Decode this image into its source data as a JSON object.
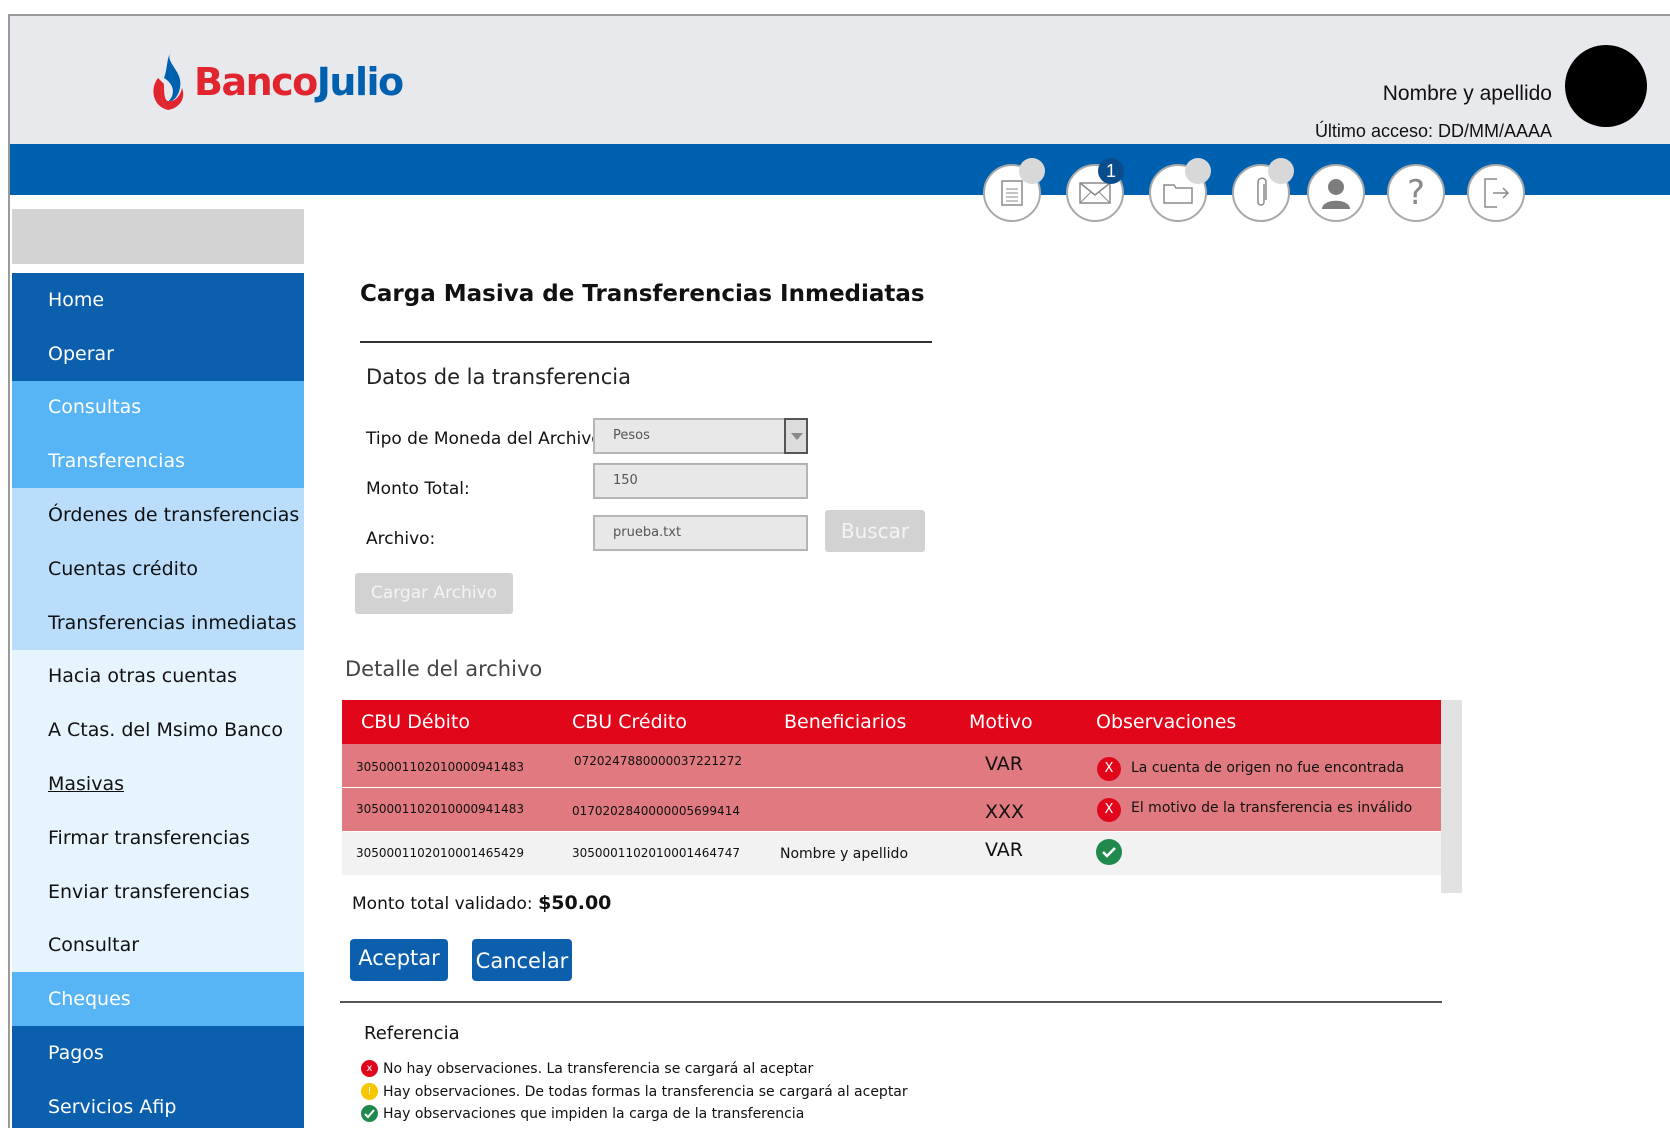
{
  "brand": {
    "name_part1": "Banco",
    "name_part2": "Julio"
  },
  "user": {
    "name": "Nombre y apellido",
    "last_access": "Último acceso: DD/MM/AAAA"
  },
  "toolbar": {
    "icons": [
      "document-icon",
      "mail-icon",
      "folder-icon",
      "paperclip-icon",
      "user-profile-icon",
      "help-icon",
      "logout-icon"
    ],
    "mail_badge": "1"
  },
  "sidebar": {
    "items": [
      {
        "label": "Home"
      },
      {
        "label": "Operar"
      },
      {
        "label": "Consultas"
      },
      {
        "label": "Transferencias"
      },
      {
        "label": "Órdenes de transferencias"
      },
      {
        "label": "Cuentas crédito"
      },
      {
        "label": "Transferencias inmediatas"
      },
      {
        "label": "Hacia otras cuentas"
      },
      {
        "label": "A Ctas. del Msimo Banco"
      },
      {
        "label": "Masivas"
      },
      {
        "label": "Firmar transferencias"
      },
      {
        "label": "Enviar transferencias"
      },
      {
        "label": "Consultar"
      },
      {
        "label": "Cheques"
      },
      {
        "label": "Pagos"
      },
      {
        "label": "Servicios Afip"
      }
    ]
  },
  "main": {
    "title": "Carga Masiva de Transferencias Inmediatas",
    "section_title": "Datos de la transferencia",
    "form": {
      "currency_label": "Tipo de Moneda del Archivo:",
      "currency_value": "Pesos",
      "amount_label": "Monto Total:",
      "amount_value": "150",
      "file_label": "Archivo:",
      "file_value": "prueba.txt",
      "search_button": "Buscar",
      "load_button": "Cargar Archivo"
    },
    "detail_title": "Detalle del archivo",
    "table": {
      "headers": [
        "CBU Débito",
        "CBU Crédito",
        "Beneficiarios",
        "Motivo",
        "Observaciones"
      ],
      "rows": [
        {
          "debit": "3050001102010000941483",
          "credit": "0720247880000037221272",
          "beneficiary": "",
          "reason": "VAR",
          "status": "error",
          "status_icon": "X",
          "observation": "La cuenta de origen no fue encontrada"
        },
        {
          "debit": "3050001102010000941483",
          "credit": "0170202840000005699414",
          "beneficiary": "",
          "reason": "XXX",
          "status": "error",
          "status_icon": "X",
          "observation": "El motivo de la transferencia es inválido"
        },
        {
          "debit": "3050001102010001465429",
          "credit": "3050001102010001464747",
          "beneficiary": "Nombre y apellido",
          "reason": "VAR",
          "status": "ok",
          "status_icon": "",
          "observation": ""
        }
      ]
    },
    "total_label": "Monto total validado:",
    "total_value": "$50.00",
    "accept_button": "Aceptar",
    "cancel_button": "Cancelar",
    "reference": {
      "title": "Referencia",
      "items": [
        {
          "color": "#e2061b",
          "glyph": "x",
          "text": "No hay observaciones. La transferencia se cargará al aceptar"
        },
        {
          "color": "#f7c600",
          "glyph": "!",
          "text": "Hay observaciones. De todas formas la transferencia se cargará al aceptar"
        },
        {
          "color": "#1f8a4c",
          "glyph": "",
          "text": "Hay observaciones que impiden la carga de la transferencia"
        }
      ]
    }
  },
  "colors": {
    "primary": "#0b5fad",
    "header_bar": "#0060b0",
    "table_header": "#e2061b",
    "error_row": "#e17a80",
    "ok": "#1f8a4c",
    "brand_red": "#e0252f"
  }
}
